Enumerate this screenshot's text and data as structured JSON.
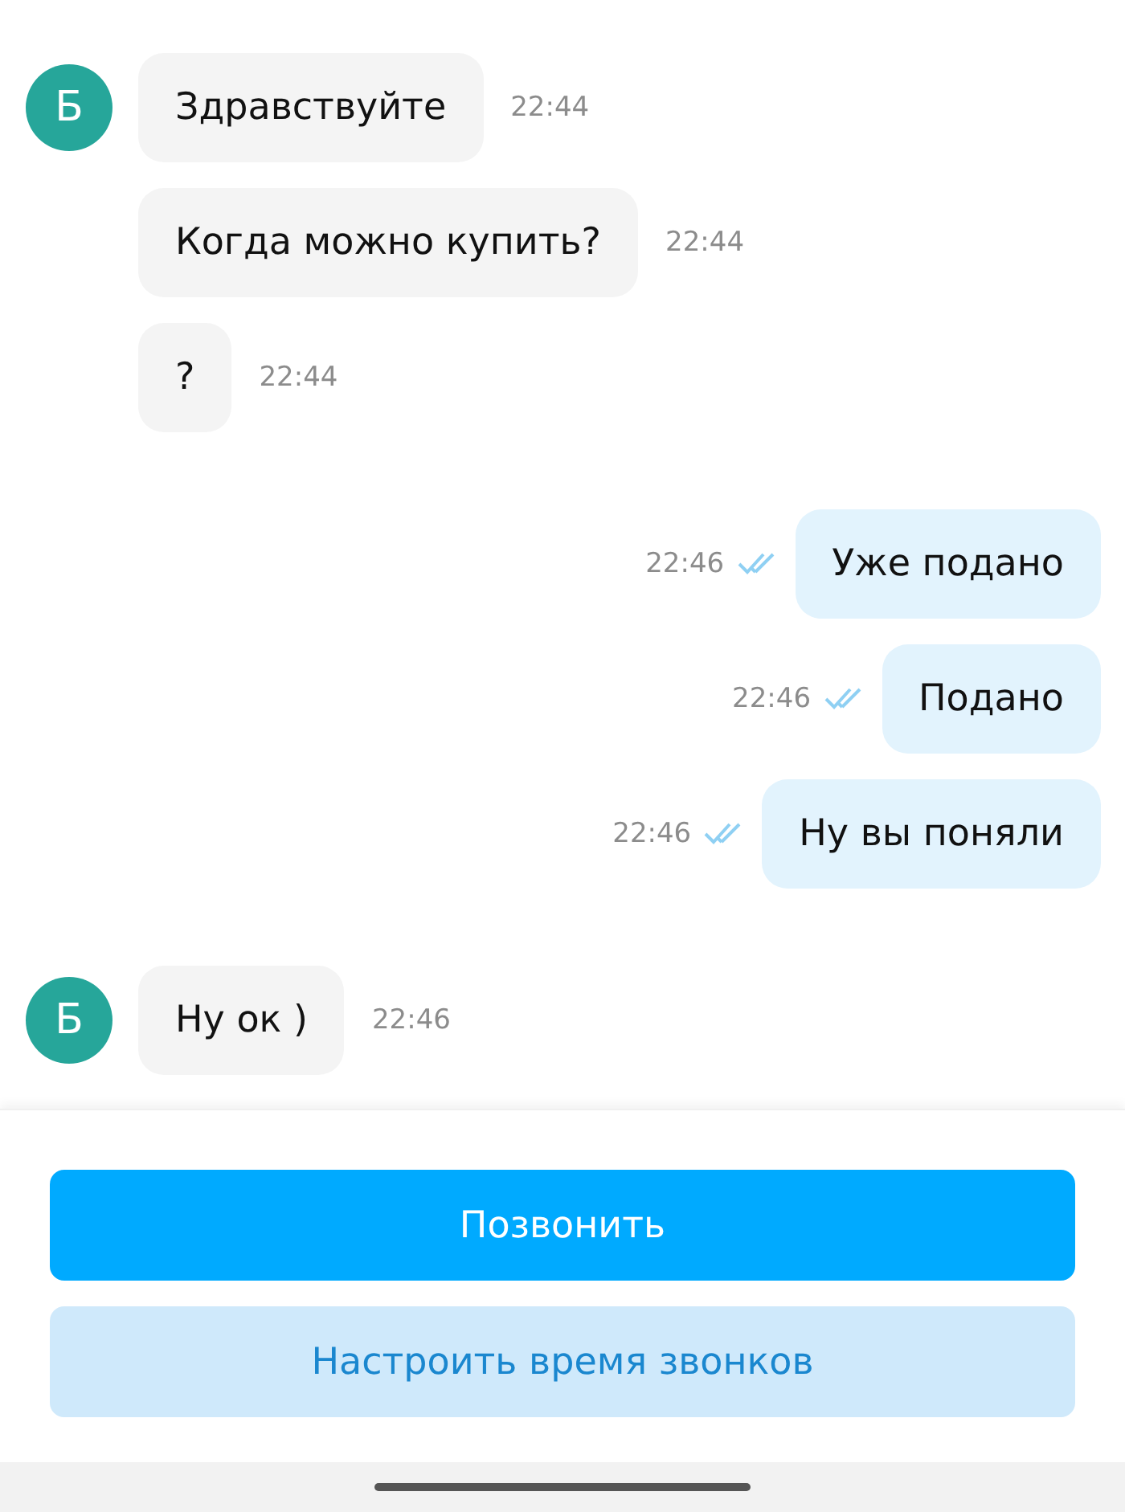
{
  "messages": [
    {
      "kind": "incoming",
      "avatar": "Б",
      "text": "Здравствуйте",
      "time": "22:44"
    },
    {
      "kind": "incoming",
      "text": "Когда можно купить?",
      "time": "22:44"
    },
    {
      "kind": "incoming",
      "text": "?",
      "time": "22:44"
    },
    {
      "kind": "outgoing",
      "text": "Уже подано",
      "time": "22:46",
      "read": true
    },
    {
      "kind": "outgoing",
      "text": "Подано",
      "time": "22:46",
      "read": true
    },
    {
      "kind": "outgoing",
      "text": "Ну вы поняли",
      "time": "22:46",
      "read": true
    },
    {
      "kind": "incoming",
      "avatar": "Б",
      "text": "Ну ок )",
      "time": "22:46"
    }
  ],
  "buttons": [
    {
      "kind": "primary",
      "label": "Позвонить"
    },
    {
      "kind": "secondary",
      "label": "Настроить время звонков"
    }
  ]
}
